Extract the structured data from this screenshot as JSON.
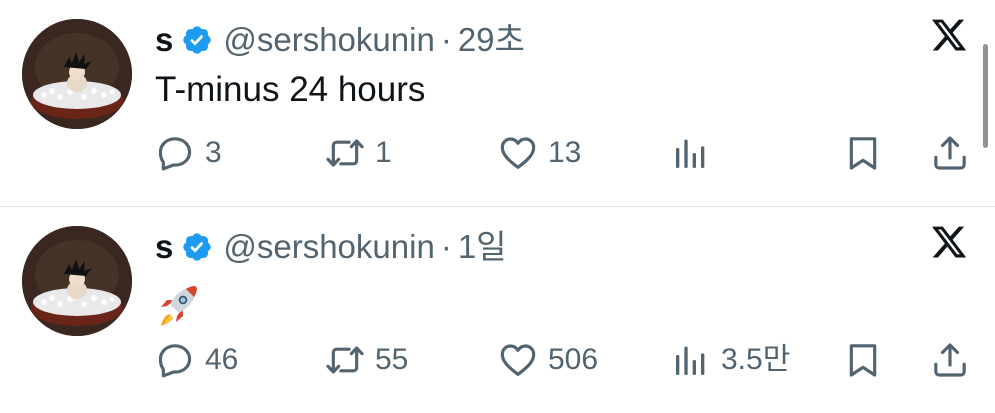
{
  "tweets": [
    {
      "name": "s",
      "handle": "@sershokunin",
      "separator": "·",
      "time": "29초",
      "text": "T-minus 24 hours",
      "replies": "3",
      "retweets": "1",
      "likes": "13",
      "views": ""
    },
    {
      "name": "s",
      "handle": "@sershokunin",
      "separator": "·",
      "time": "1일",
      "text": "",
      "emoji": "rocket",
      "replies": "46",
      "retweets": "55",
      "likes": "506",
      "views": "3.5만"
    }
  ],
  "icons": {
    "verified": "verified-badge-icon",
    "platform": "x-logo-icon",
    "reply": "reply-icon",
    "retweet": "retweet-icon",
    "like": "heart-icon",
    "views": "views-icon",
    "bookmark": "bookmark-icon",
    "share": "share-icon"
  },
  "colors": {
    "text": "#0f1419",
    "secondary": "#536471",
    "verified": "#1d9bf0",
    "divider": "#e6e9ec"
  }
}
